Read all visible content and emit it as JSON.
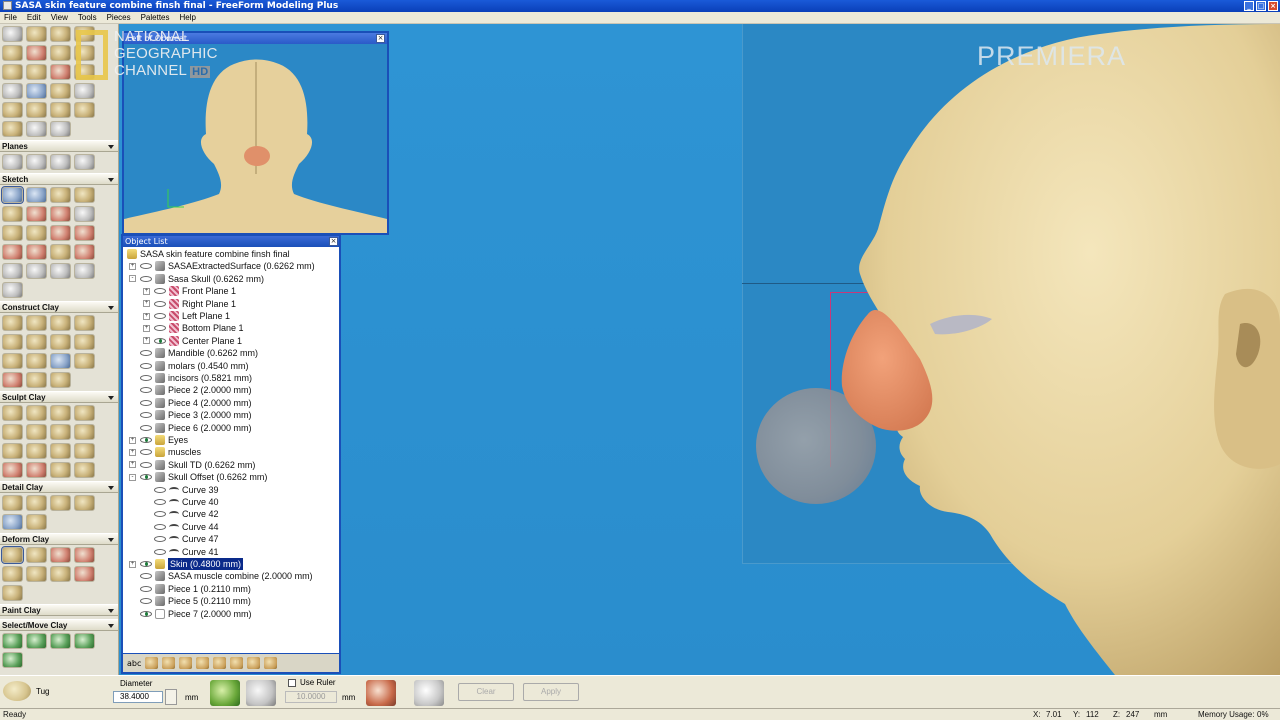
{
  "window": {
    "title": "SASA skin feature combine finsh final - FreeForm Modeling Plus"
  },
  "menu": [
    "File",
    "Edit",
    "View",
    "Tools",
    "Pieces",
    "Palettes",
    "Help"
  ],
  "left_panel": {
    "sections": [
      "Planes",
      "Sketch",
      "Construct Clay",
      "Sculpt Clay",
      "Detail Clay",
      "Deform Clay",
      "Paint Clay",
      "Select/Move Clay"
    ]
  },
  "front_view": {
    "title": "Left of Obmeat"
  },
  "watermark": {
    "line1": "NATIONAL",
    "line2": "GEOGRAPHIC",
    "line3": "CHANNEL",
    "hd": "HD",
    "premiera": "PREMIERA"
  },
  "object_list": {
    "title": "Object List",
    "items": [
      {
        "label": "SASA skin feature combine finsh final",
        "level": 0,
        "icon": "folder",
        "expander": ""
      },
      {
        "label": "SASAExtractedSurface (0.6262 mm)",
        "level": 1,
        "icon": "piece",
        "expander": "+"
      },
      {
        "label": "Sasa Skull (0.6262 mm)",
        "level": 1,
        "icon": "piece",
        "expander": "-"
      },
      {
        "label": "Front Plane 1",
        "level": 2,
        "icon": "plane",
        "expander": "+"
      },
      {
        "label": "Right Plane 1",
        "level": 2,
        "icon": "plane",
        "expander": "+"
      },
      {
        "label": "Left Plane 1",
        "level": 2,
        "icon": "plane",
        "expander": "+"
      },
      {
        "label": "Bottom Plane 1",
        "level": 2,
        "icon": "plane",
        "expander": "+"
      },
      {
        "label": "Center Plane 1",
        "level": 2,
        "icon": "plane",
        "expander": "+"
      },
      {
        "label": "Mandible (0.6262 mm)",
        "level": 1,
        "icon": "piece",
        "expander": ""
      },
      {
        "label": "molars (0.4540 mm)",
        "level": 1,
        "icon": "piece",
        "expander": ""
      },
      {
        "label": "incisors (0.5821 mm)",
        "level": 1,
        "icon": "piece",
        "expander": ""
      },
      {
        "label": "Piece 2 (2.0000 mm)",
        "level": 1,
        "icon": "piece",
        "expander": ""
      },
      {
        "label": "Piece 4 (2.0000 mm)",
        "level": 1,
        "icon": "piece",
        "expander": ""
      },
      {
        "label": "Piece 3 (2.0000 mm)",
        "level": 1,
        "icon": "piece",
        "expander": ""
      },
      {
        "label": "Piece 6 (2.0000 mm)",
        "level": 1,
        "icon": "piece",
        "expander": ""
      },
      {
        "label": "Eyes",
        "level": 1,
        "icon": "folder",
        "expander": "+"
      },
      {
        "label": "muscles",
        "level": 1,
        "icon": "folder",
        "expander": "+"
      },
      {
        "label": "Skull TD (0.6262 mm)",
        "level": 1,
        "icon": "piece",
        "expander": "+"
      },
      {
        "label": "Skull Offset (0.6262 mm)",
        "level": 1,
        "icon": "piece",
        "expander": "-"
      },
      {
        "label": "Curve 39",
        "level": 2,
        "icon": "curve",
        "expander": ""
      },
      {
        "label": "Curve 40",
        "level": 2,
        "icon": "curve",
        "expander": ""
      },
      {
        "label": "Curve 42",
        "level": 2,
        "icon": "curve",
        "expander": ""
      },
      {
        "label": "Curve 44",
        "level": 2,
        "icon": "curve",
        "expander": ""
      },
      {
        "label": "Curve 47",
        "level": 2,
        "icon": "curve",
        "expander": ""
      },
      {
        "label": "Curve 41",
        "level": 2,
        "icon": "curve",
        "expander": ""
      },
      {
        "label": "Skin (0.4800 mm)",
        "level": 1,
        "icon": "folder",
        "expander": "+",
        "selected": true
      },
      {
        "label": "SASA muscle combine (2.0000 mm)",
        "level": 1,
        "icon": "piece",
        "expander": ""
      },
      {
        "label": "Piece 1 (0.2110 mm)",
        "level": 1,
        "icon": "piece",
        "expander": ""
      },
      {
        "label": "Piece 5 (0.2110 mm)",
        "level": 1,
        "icon": "piece",
        "expander": ""
      },
      {
        "label": "Piece 7 (2.0000 mm)",
        "level": 1,
        "icon": "white",
        "expander": ""
      }
    ],
    "footer_label": "abc"
  },
  "toolbar": {
    "tool_name": "Tug",
    "diameter_label": "Diameter",
    "diameter_value": "38.4000",
    "diameter_unit": "mm",
    "use_ruler_label": "Use Ruler",
    "ruler_value": "10.0000",
    "ruler_unit": "mm",
    "clear_label": "Clear",
    "apply_label": "Apply"
  },
  "status": {
    "text": "Ready",
    "x_label": "X:",
    "x_value": "7.01",
    "y_label": "Y:",
    "y_value": "112",
    "z_label": "Z:",
    "z_value": "247",
    "unit": "mm",
    "memory_label": "Memory Usage:",
    "memory_value": "0%"
  },
  "colors": {
    "viewport_bg": "#2c8fcf",
    "skin": "#e8d4a0",
    "nose_paint": "#e0906a",
    "selection": "#0a2a8a"
  }
}
